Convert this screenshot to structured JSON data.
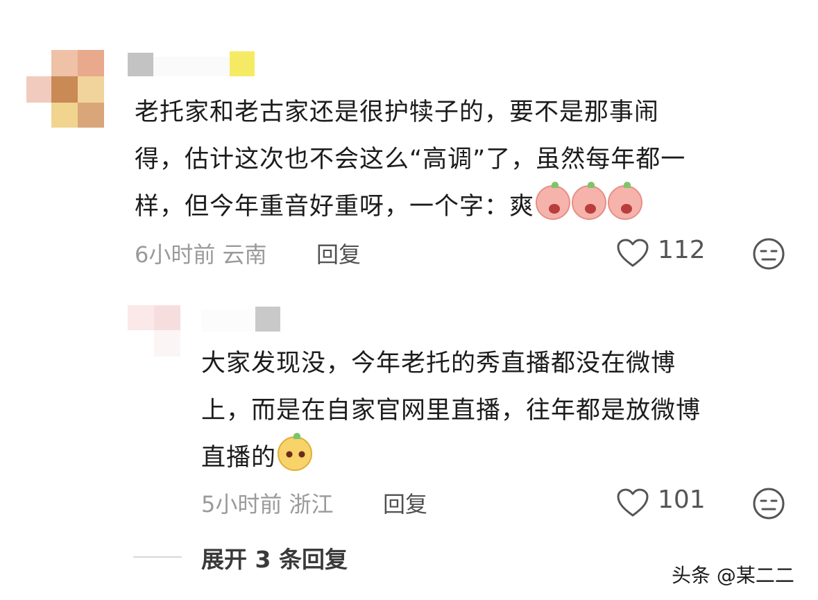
{
  "comments": [
    {
      "text_lines": [
        "老托家和老古家还是很护犊子的，要不是那事闹",
        "得，估计这次也不会这么“高调”了，虽然每年都一",
        "样，但今年重音好重呀，一个字：爽"
      ],
      "emojis": [
        "shocked-face-emoji",
        "shocked-face-emoji",
        "shocked-face-emoji"
      ],
      "time": "6小时前",
      "location": "云南",
      "reply_label": "回复",
      "likes": "112"
    },
    {
      "text_lines": [
        "大家发现没，今年老托的秀直播都没在微博",
        "上，而是在自家官网里直播，往年都是放微博",
        "直播的"
      ],
      "emojis": [
        "sly-face-emoji"
      ],
      "time": "5小时前",
      "location": "浙江",
      "reply_label": "回复",
      "likes": "101"
    }
  ],
  "expand_replies": "展开 3 条回复",
  "watermark": "头条 @某二二",
  "colors": {
    "text": "#1c1c1c",
    "meta": "#9a9a9a",
    "icon": "#555555"
  }
}
